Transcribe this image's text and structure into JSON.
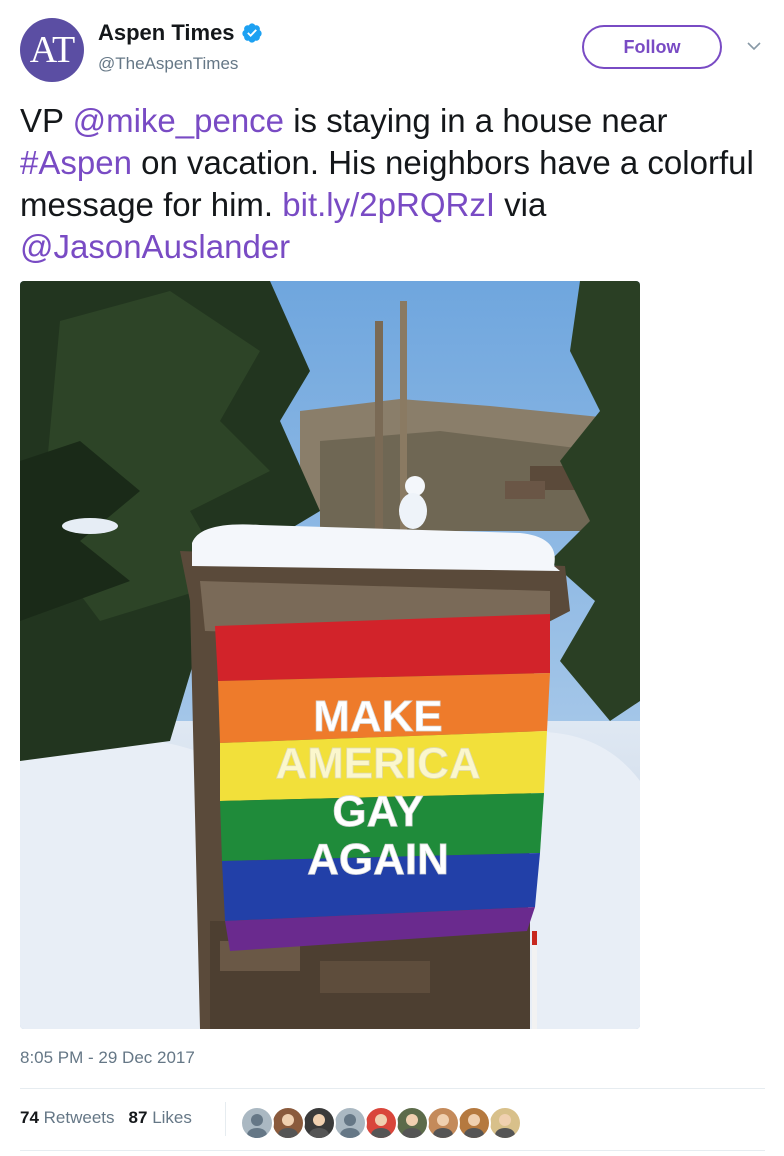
{
  "author": {
    "avatar_initials": "AT",
    "name": "Aspen Times",
    "handle": "@TheAspenTimes",
    "verified": true,
    "avatar_color": "#5b4ea3"
  },
  "actions": {
    "follow_label": "Follow",
    "more_icon": "chevron-down-icon"
  },
  "tweet": {
    "part1": "VP ",
    "mention1": "@mike_pence",
    "part2": " is staying in a house near ",
    "hashtag": "#Aspen",
    "part3": " on vacation. His neighbors have a colorful message for him. ",
    "url": "bit.ly/2pRQRzI",
    "part4": " via ",
    "mention2": "@JasonAuslander"
  },
  "photo": {
    "flag_text": [
      "MAKE",
      "AMERICA",
      "GAY",
      "AGAIN"
    ]
  },
  "timestamp": "8:05 PM - 29 Dec 2017",
  "stats": {
    "retweets_count": "74",
    "retweets_label": "Retweets",
    "likes_count": "87",
    "likes_label": "Likes"
  },
  "likers": [
    {
      "icon": "default-avatar-icon",
      "color": "#aab8c2"
    },
    {
      "icon": "user-avatar-icon",
      "color": "#8a5a3c"
    },
    {
      "icon": "user-avatar-icon",
      "color": "#3a3a3a"
    },
    {
      "icon": "default-avatar-icon",
      "color": "#aab8c2"
    },
    {
      "icon": "user-avatar-icon",
      "color": "#d9463b"
    },
    {
      "icon": "user-avatar-icon",
      "color": "#5c6b4a"
    },
    {
      "icon": "user-avatar-icon",
      "color": "#c48a5a"
    },
    {
      "icon": "user-avatar-icon",
      "color": "#b5793f"
    },
    {
      "icon": "user-avatar-icon",
      "color": "#d8c08a"
    }
  ],
  "colors": {
    "link": "#794bc4",
    "secondary_text": "#657786"
  }
}
